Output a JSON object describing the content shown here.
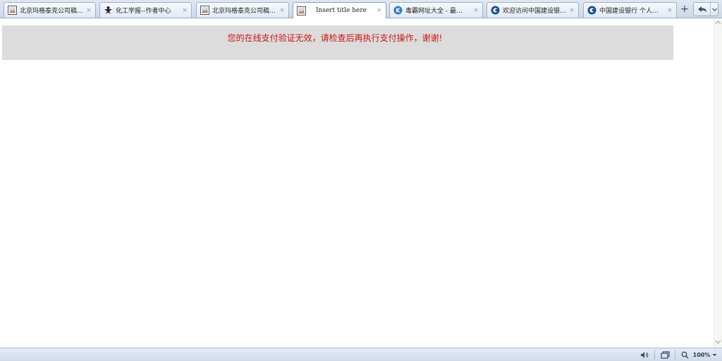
{
  "tabs": [
    {
      "label": "北京玛格泰克公司稿…",
      "icon": "image-page-icon",
      "active": false
    },
    {
      "label": "化工学报--作者中心",
      "icon": "person-logo-icon",
      "active": false
    },
    {
      "label": "北京玛格泰克公司稿…",
      "icon": "image-page-icon",
      "active": false
    },
    {
      "label": "Insert title here",
      "icon": "image-page-icon",
      "active": true
    },
    {
      "label": "毒霸网址大全 - 最…",
      "icon": "k-logo-icon",
      "active": false
    },
    {
      "label": "欢迎访问中国建设银…",
      "icon": "ccb-logo-icon",
      "active": false
    },
    {
      "label": "中国建设银行 个人…",
      "icon": "ccb-logo-icon",
      "active": false
    }
  ],
  "tab_close_glyph": "×",
  "new_tab_glyph": "+",
  "message": "您的在线支付验证无效，请检查后再执行支付操作，谢谢!",
  "status": {
    "zoom": "100%"
  },
  "colors": {
    "message_text": "#d01010",
    "message_bar": "#dcdcdc",
    "tab_accent": "#3c7dc4"
  }
}
